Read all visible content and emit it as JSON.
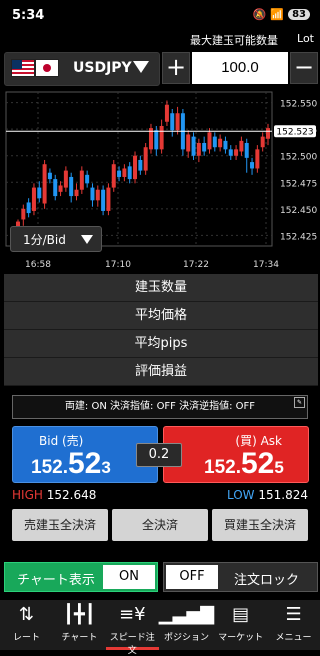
{
  "status": {
    "time": "5:34",
    "battery": "83"
  },
  "header": {
    "max_qty_label": "最大建玉可能数量",
    "lot_label": "Lot"
  },
  "pair": {
    "symbol": "USDJPY"
  },
  "quantity": {
    "value": "100.0",
    "plus": "+",
    "minus": "−"
  },
  "chart": {
    "timeframe": "1分/Bid",
    "current_price_label": "152.523"
  },
  "chart_data": {
    "type": "candlestick",
    "y_ticks": [
      "152.550",
      "152.525",
      "152.500",
      "152.475",
      "152.450",
      "152.425"
    ],
    "x_ticks": [
      "16:58",
      "17:10",
      "17:22",
      "17:34"
    ],
    "current_price": 152.523,
    "candles": [
      {
        "o": 152.432,
        "c": 152.438,
        "h": 152.44,
        "l": 152.426
      },
      {
        "o": 152.44,
        "c": 152.45,
        "h": 152.454,
        "l": 152.434
      },
      {
        "o": 152.456,
        "c": 152.446,
        "h": 152.46,
        "l": 152.442
      },
      {
        "o": 152.448,
        "c": 152.47,
        "h": 152.474,
        "l": 152.444
      },
      {
        "o": 152.47,
        "c": 152.46,
        "h": 152.476,
        "l": 152.456
      },
      {
        "o": 152.455,
        "c": 152.492,
        "h": 152.496,
        "l": 152.45
      },
      {
        "o": 152.484,
        "c": 152.478,
        "h": 152.488,
        "l": 152.474
      },
      {
        "o": 152.478,
        "c": 152.462,
        "h": 152.482,
        "l": 152.458
      },
      {
        "o": 152.466,
        "c": 152.472,
        "h": 152.476,
        "l": 152.462
      },
      {
        "o": 152.47,
        "c": 152.486,
        "h": 152.49,
        "l": 152.466
      },
      {
        "o": 152.48,
        "c": 152.462,
        "h": 152.484,
        "l": 152.456
      },
      {
        "o": 152.462,
        "c": 152.468,
        "h": 152.474,
        "l": 152.458
      },
      {
        "o": 152.468,
        "c": 152.486,
        "h": 152.49,
        "l": 152.464
      },
      {
        "o": 152.482,
        "c": 152.474,
        "h": 152.486,
        "l": 152.47
      },
      {
        "o": 152.47,
        "c": 152.458,
        "h": 152.474,
        "l": 152.452
      },
      {
        "o": 152.458,
        "c": 152.468,
        "h": 152.472,
        "l": 152.452
      },
      {
        "o": 152.468,
        "c": 152.448,
        "h": 152.472,
        "l": 152.444
      },
      {
        "o": 152.448,
        "c": 152.47,
        "h": 152.474,
        "l": 152.444
      },
      {
        "o": 152.47,
        "c": 152.492,
        "h": 152.496,
        "l": 152.466
      },
      {
        "o": 152.486,
        "c": 152.48,
        "h": 152.49,
        "l": 152.476
      },
      {
        "o": 152.48,
        "c": 152.488,
        "h": 152.492,
        "l": 152.476
      },
      {
        "o": 152.49,
        "c": 152.478,
        "h": 152.494,
        "l": 152.474
      },
      {
        "o": 152.478,
        "c": 152.5,
        "h": 152.504,
        "l": 152.474
      },
      {
        "o": 152.496,
        "c": 152.486,
        "h": 152.5,
        "l": 152.482
      },
      {
        "o": 152.486,
        "c": 152.508,
        "h": 152.512,
        "l": 152.482
      },
      {
        "o": 152.506,
        "c": 152.526,
        "h": 152.53,
        "l": 152.502
      },
      {
        "o": 152.524,
        "c": 152.506,
        "h": 152.528,
        "l": 152.5
      },
      {
        "o": 152.506,
        "c": 152.528,
        "h": 152.534,
        "l": 152.502
      },
      {
        "o": 152.532,
        "c": 152.548,
        "h": 152.552,
        "l": 152.528
      },
      {
        "o": 152.54,
        "c": 152.524,
        "h": 152.544,
        "l": 152.518
      },
      {
        "o": 152.524,
        "c": 152.54,
        "h": 152.546,
        "l": 152.52
      },
      {
        "o": 152.54,
        "c": 152.506,
        "h": 152.544,
        "l": 152.5
      },
      {
        "o": 152.504,
        "c": 152.52,
        "h": 152.524,
        "l": 152.498
      },
      {
        "o": 152.518,
        "c": 152.5,
        "h": 152.522,
        "l": 152.496
      },
      {
        "o": 152.5,
        "c": 152.512,
        "h": 152.516,
        "l": 152.494
      },
      {
        "o": 152.512,
        "c": 152.504,
        "h": 152.518,
        "l": 152.5
      },
      {
        "o": 152.506,
        "c": 152.522,
        "h": 152.526,
        "l": 152.502
      },
      {
        "o": 152.518,
        "c": 152.508,
        "h": 152.522,
        "l": 152.504
      },
      {
        "o": 152.508,
        "c": 152.516,
        "h": 152.52,
        "l": 152.504
      },
      {
        "o": 152.514,
        "c": 152.506,
        "h": 152.518,
        "l": 152.502
      },
      {
        "o": 152.506,
        "c": 152.5,
        "h": 152.51,
        "l": 152.496
      },
      {
        "o": 152.5,
        "c": 152.506,
        "h": 152.51,
        "l": 152.496
      },
      {
        "o": 152.504,
        "c": 152.514,
        "h": 152.518,
        "l": 152.5
      },
      {
        "o": 152.512,
        "c": 152.498,
        "h": 152.516,
        "l": 152.484
      },
      {
        "o": 152.494,
        "c": 152.488,
        "h": 152.498,
        "l": 152.482
      },
      {
        "o": 152.488,
        "c": 152.506,
        "h": 152.51,
        "l": 152.484
      },
      {
        "o": 152.508,
        "c": 152.518,
        "h": 152.522,
        "l": 152.504
      },
      {
        "o": 152.516,
        "c": 152.526,
        "h": 152.53,
        "l": 152.51
      }
    ],
    "colors": {
      "up": "#e53935",
      "down": "#2196f3"
    }
  },
  "info": {
    "rows": [
      "建玉数量",
      "平均価格",
      "平均pips",
      "評価損益"
    ]
  },
  "settings_text": "両建: ON 決済指値: OFF 決済逆指値: OFF",
  "bid": {
    "label": "Bid (売)",
    "p1": "152.",
    "p2": "52",
    "p3": "3"
  },
  "ask": {
    "label": "(買) Ask",
    "p1": "152.",
    "p2": "52",
    "p3": "5"
  },
  "spread": "0.2",
  "high": {
    "label": "HIGH",
    "value": "152.648"
  },
  "low": {
    "label": "LOW",
    "value": "151.824"
  },
  "buttons": {
    "close_sell": "売建玉全決済",
    "close_all": "全決済",
    "close_buy": "買建玉全決済"
  },
  "chart_toggle": {
    "label": "チャート表示",
    "state": "ON"
  },
  "lock_toggle": {
    "label": "注文ロック",
    "state": "OFF"
  },
  "nav": [
    {
      "label": "レート",
      "icon": "rate-icon"
    },
    {
      "label": "チャート",
      "icon": "chart-icon"
    },
    {
      "label": "スピード注文",
      "icon": "speed-order-icon"
    },
    {
      "label": "ポジション",
      "icon": "position-icon"
    },
    {
      "label": "マーケット",
      "icon": "market-icon"
    },
    {
      "label": "メニュー",
      "icon": "menu-icon"
    }
  ]
}
